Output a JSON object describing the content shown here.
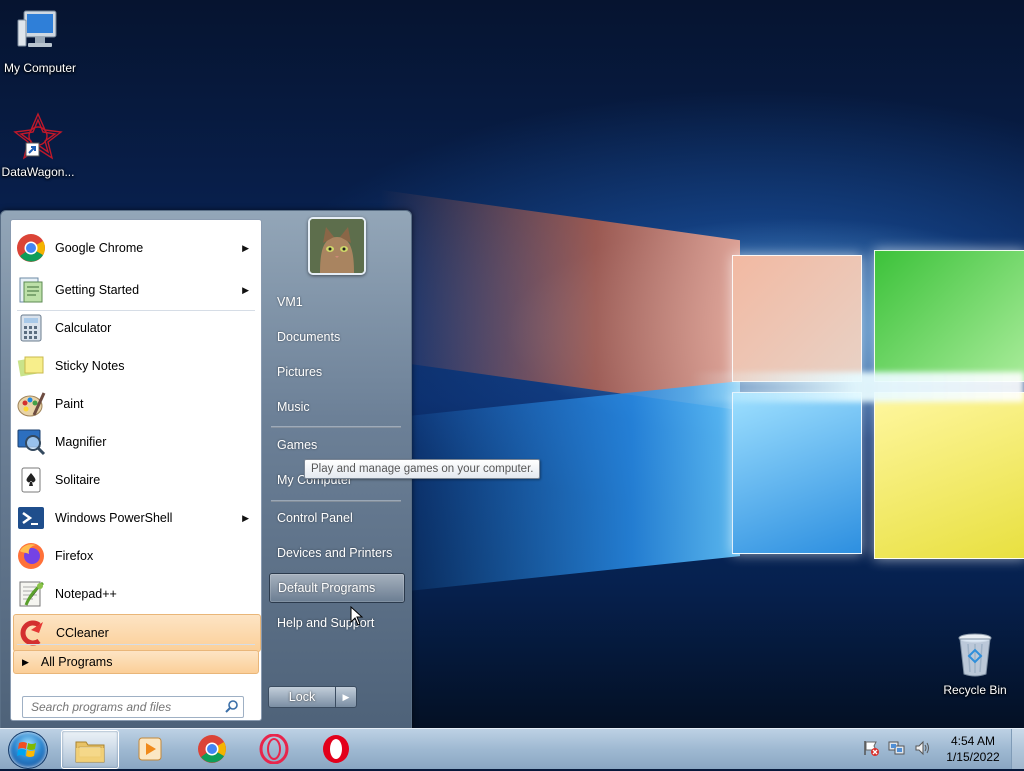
{
  "desktop": {
    "icons": [
      {
        "id": "my-computer",
        "label": "My Computer"
      },
      {
        "id": "datawagon",
        "label": "DataWagon..."
      },
      {
        "id": "recycle-bin",
        "label": "Recycle Bin"
      }
    ]
  },
  "start_menu": {
    "pinned": [
      {
        "label": "Google Chrome",
        "icon": "chrome-icon",
        "has_submenu": true
      },
      {
        "label": "Getting Started",
        "icon": "getting-started-icon",
        "has_submenu": true
      },
      {
        "label": "Calculator",
        "icon": "calculator-icon",
        "has_submenu": false
      },
      {
        "label": "Sticky Notes",
        "icon": "sticky-notes-icon",
        "has_submenu": false
      },
      {
        "label": "Paint",
        "icon": "paint-icon",
        "has_submenu": false
      },
      {
        "label": "Magnifier",
        "icon": "magnifier-icon",
        "has_submenu": false
      },
      {
        "label": "Solitaire",
        "icon": "solitaire-icon",
        "has_submenu": false
      },
      {
        "label": "Windows PowerShell",
        "icon": "powershell-icon",
        "has_submenu": true
      },
      {
        "label": "Firefox",
        "icon": "firefox-icon",
        "has_submenu": false
      },
      {
        "label": "Notepad++",
        "icon": "notepadpp-icon",
        "has_submenu": false
      },
      {
        "label": "CCleaner",
        "icon": "ccleaner-icon",
        "has_submenu": false,
        "highlighted": true
      }
    ],
    "all_programs_label": "All Programs",
    "search_placeholder": "Search programs and files",
    "right_links": [
      {
        "label": "VM1"
      },
      {
        "label": "Documents"
      },
      {
        "label": "Pictures"
      },
      {
        "label": "Music"
      },
      {
        "label": "Games"
      },
      {
        "label": "My Computer"
      },
      {
        "label": "Control Panel"
      },
      {
        "label": "Devices and Printers"
      },
      {
        "label": "Default Programs",
        "highlighted": true
      },
      {
        "label": "Help and Support"
      }
    ],
    "lock_label": "Lock"
  },
  "tooltip": {
    "text": "Play and manage games on your computer."
  },
  "taskbar": {
    "items": [
      {
        "name": "file-explorer",
        "icon": "folder-icon",
        "active": true
      },
      {
        "name": "media-player",
        "icon": "media-player-icon",
        "active": false
      },
      {
        "name": "chrome",
        "icon": "chrome-icon",
        "active": false
      },
      {
        "name": "opera-gx",
        "icon": "opera-gx-icon",
        "active": false
      },
      {
        "name": "opera",
        "icon": "opera-icon",
        "active": false
      }
    ],
    "clock": {
      "time": "4:54 AM",
      "date": "1/15/2022"
    }
  },
  "colors": {
    "highlight_orange": "#fbcf98",
    "taskbar_blue": "#9fb9d2",
    "menu_slate": "#6c8097"
  }
}
